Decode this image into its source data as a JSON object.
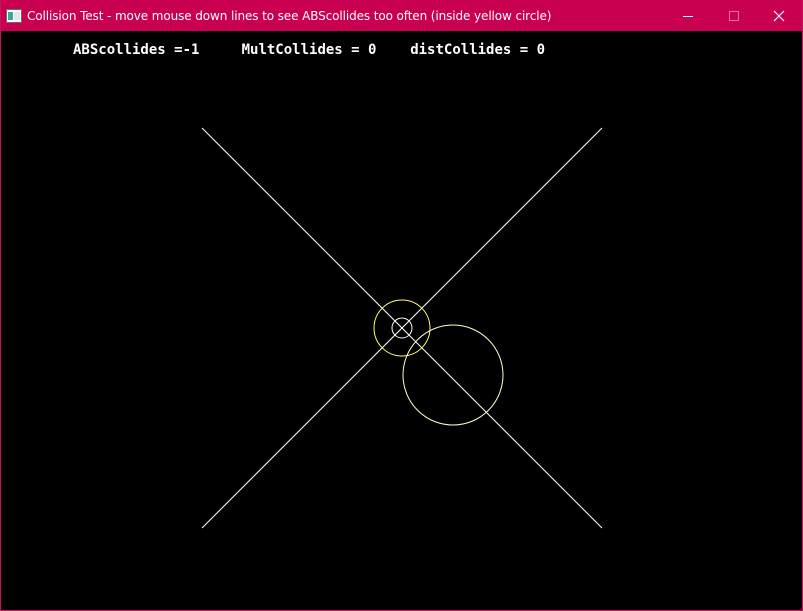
{
  "window": {
    "title": "Collision Test - move mouse down lines to see ABScollides too often (inside yellow circle)"
  },
  "status": {
    "abs_label": "ABScollides =",
    "abs_value": "-1",
    "mult_label": "MultCollides = ",
    "mult_value": "0",
    "dist_label": "distCollides = ",
    "dist_value": "0"
  },
  "scene": {
    "line_color": "#ffffff",
    "yellow_circle_color": "#ffff66",
    "white_circle_color": "#ffffcc",
    "inner_circle_color": "#ffffff"
  },
  "icons": {
    "app": "app-icon",
    "minimize": "minimize-icon",
    "maximize": "maximize-icon",
    "close": "close-icon"
  },
  "colors": {
    "titlebar": "#c8004f",
    "background": "#000000",
    "text": "#ffffff"
  }
}
